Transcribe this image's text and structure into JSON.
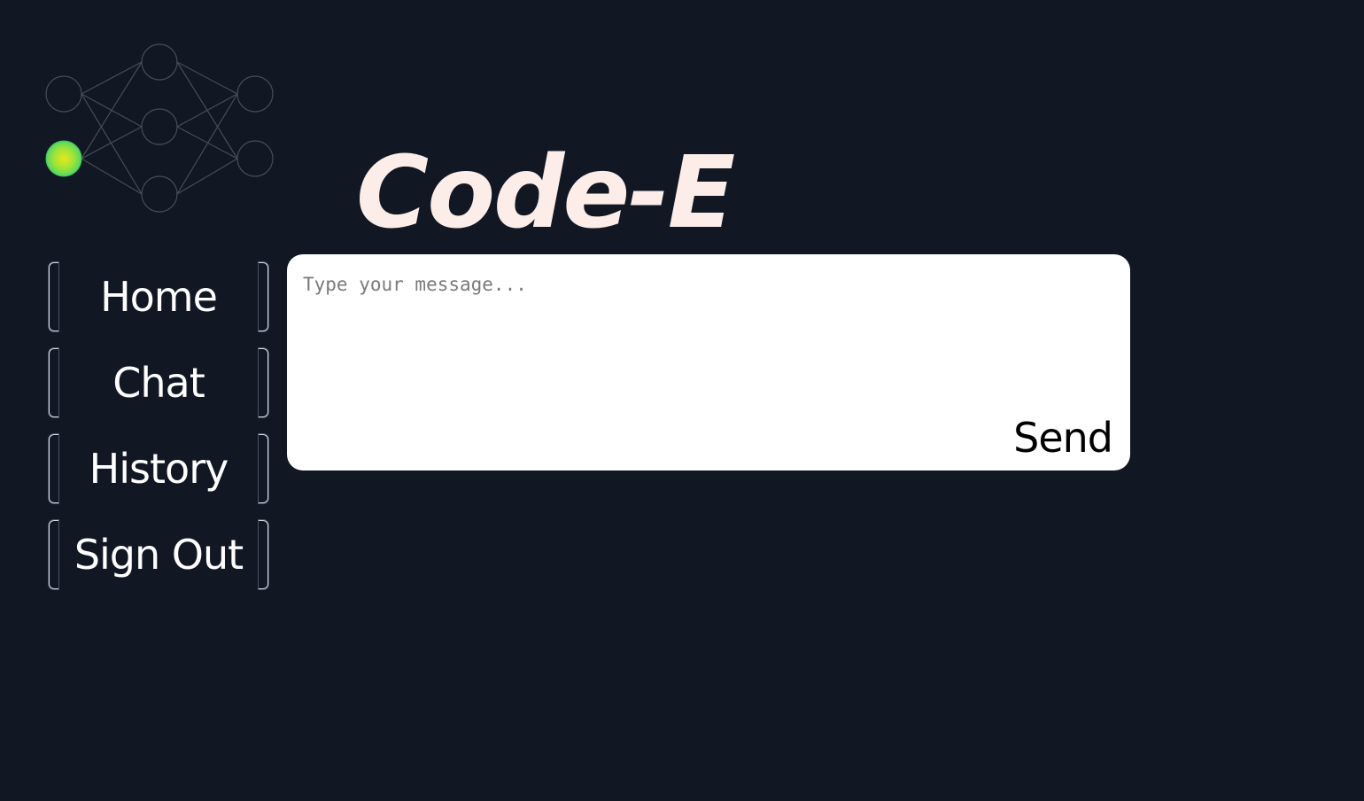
{
  "app": {
    "title": "Code-E"
  },
  "logo": {
    "icon": "neural-network-icon",
    "active_node_color": "#7fe04a"
  },
  "nav": {
    "items": [
      {
        "label": "Home"
      },
      {
        "label": "Chat"
      },
      {
        "label": "History"
      },
      {
        "label": "Sign Out"
      }
    ]
  },
  "chat": {
    "placeholder": "Type your message...",
    "value": "",
    "send_label": "Send"
  },
  "colors": {
    "background": "#111723",
    "title": "#fcede8",
    "panel": "#ffffff"
  }
}
